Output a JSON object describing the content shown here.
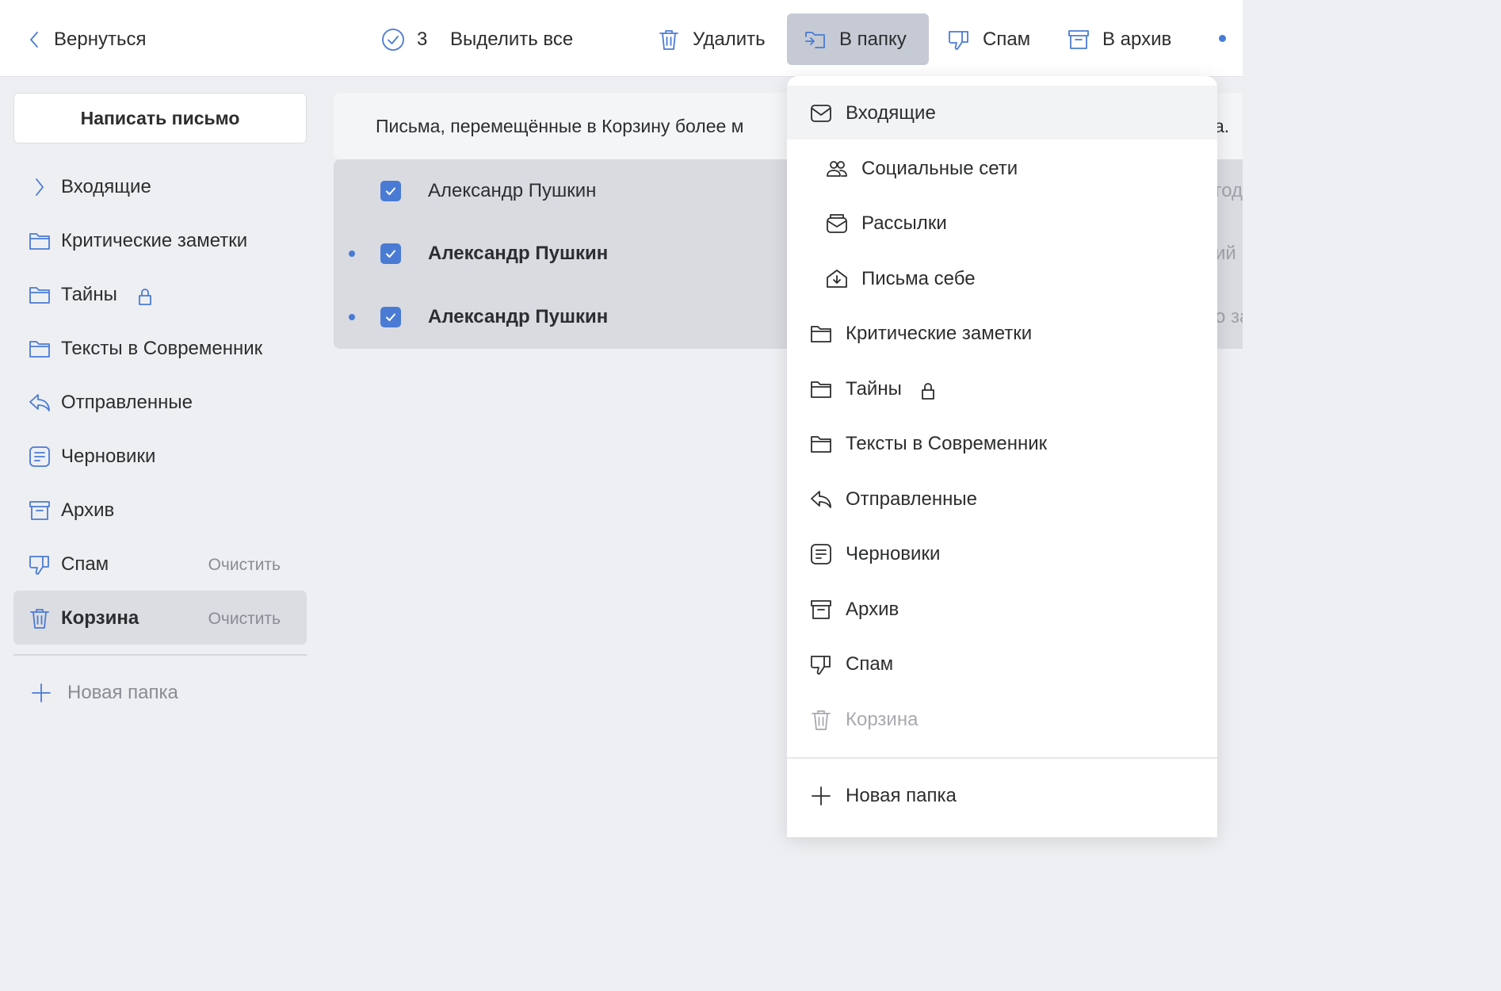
{
  "toolbar": {
    "back_label": "Вернуться",
    "selected_count": "3",
    "select_all_label": "Выделить все",
    "delete_label": "Удалить",
    "to_folder_label": "В папку",
    "spam_label": "Спам",
    "archive_label": "В архив"
  },
  "sidebar": {
    "compose_label": "Написать письмо",
    "items": [
      {
        "label": "Входящие",
        "icon": "chevron-right-icon"
      },
      {
        "label": "Критические заметки",
        "icon": "folder-icon"
      },
      {
        "label": "Тайны",
        "icon": "folder-icon",
        "locked": true
      },
      {
        "label": "Тексты в Современник",
        "icon": "folder-icon"
      },
      {
        "label": "Отправленные",
        "icon": "reply-icon"
      },
      {
        "label": "Черновики",
        "icon": "draft-icon"
      },
      {
        "label": "Архив",
        "icon": "archive-icon"
      },
      {
        "label": "Спам",
        "icon": "thumbs-down-icon",
        "action": "Очистить"
      },
      {
        "label": "Корзина",
        "icon": "trash-icon",
        "action": "Очистить",
        "active": true
      }
    ],
    "new_folder_label": "Новая папка"
  },
  "main": {
    "notice_text": "Письма, перемещённые в Корзину более м",
    "notice_tail": "а.",
    "messages": [
      {
        "sender": "Александр Пушкин",
        "unread": false,
        "checked": true,
        "snippet": "год"
      },
      {
        "sender": "Александр Пушкин",
        "unread": true,
        "checked": true,
        "snippet": "ий Н"
      },
      {
        "sender": "Александр Пушкин",
        "unread": true,
        "checked": true,
        "snippet": "о за"
      }
    ]
  },
  "move_menu": {
    "items": [
      {
        "label": "Входящие",
        "icon": "mail-icon"
      },
      {
        "label": "Социальные сети",
        "icon": "people-icon"
      },
      {
        "label": "Рассылки",
        "icon": "newsletter-icon"
      },
      {
        "label": "Письма себе",
        "icon": "self-mail-icon"
      },
      {
        "label": "Критические заметки",
        "icon": "folder-icon"
      },
      {
        "label": "Тайны",
        "icon": "folder-icon",
        "locked": true
      },
      {
        "label": "Тексты в Современник",
        "icon": "folder-icon"
      },
      {
        "label": "Отправленные",
        "icon": "reply-icon"
      },
      {
        "label": "Черновики",
        "icon": "draft-icon"
      },
      {
        "label": "Архив",
        "icon": "archive-icon"
      },
      {
        "label": "Спам",
        "icon": "thumbs-down-icon"
      },
      {
        "label": "Корзина",
        "icon": "trash-icon",
        "disabled": true
      }
    ],
    "new_folder_label": "Новая папка"
  },
  "colors": {
    "accent": "#4a7bd4",
    "active_button_bg": "#c6cad4",
    "selected_rows_bg": "#d9dbe1",
    "sidebar_bg": "#eeeff2"
  }
}
